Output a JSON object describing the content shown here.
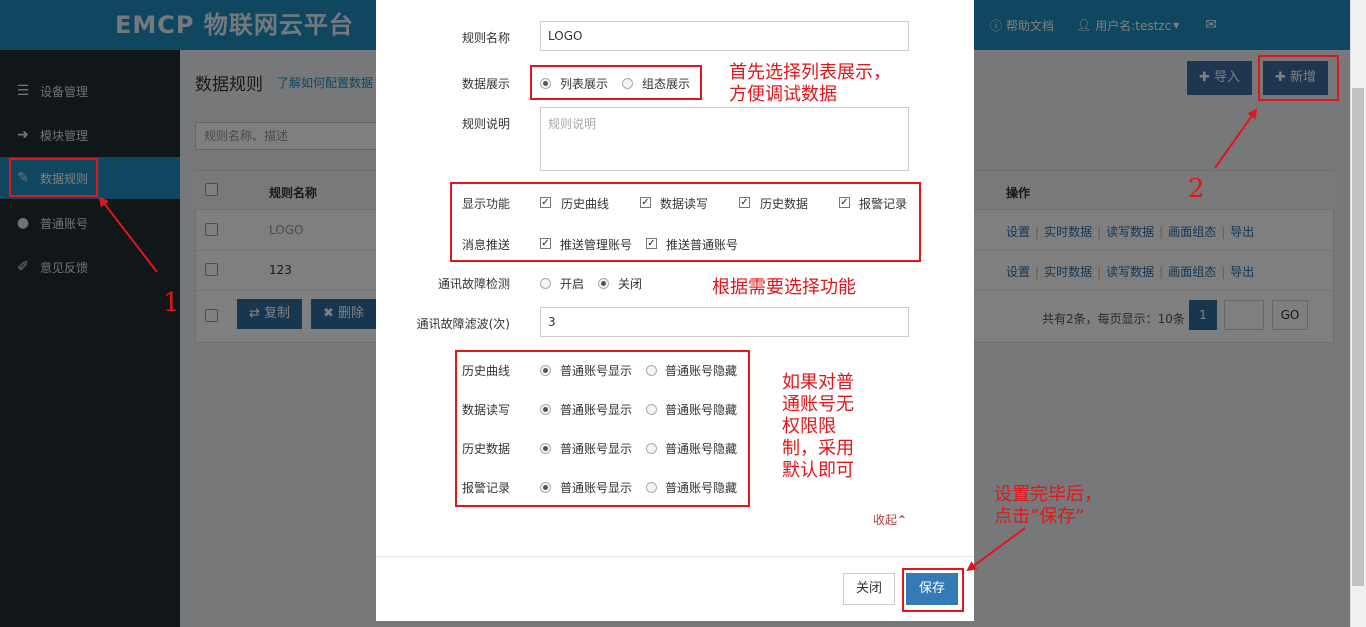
{
  "app": {
    "logo": "EMCP 物联网云平台",
    "help": "帮助文档",
    "user": "用户名:testzc",
    "icons": {
      "help": "question-circle-icon",
      "user": "user-icon",
      "mail": "envelope-icon"
    }
  },
  "sidebar": {
    "items": [
      {
        "label": "设备管理",
        "icon": "list-icon"
      },
      {
        "label": "模块管理",
        "icon": "sign-in-icon"
      },
      {
        "label": "数据规则",
        "icon": "pencil-icon",
        "active": true
      },
      {
        "label": "普通账号",
        "icon": "user-icon"
      },
      {
        "label": "意见反馈",
        "icon": "edit-icon"
      }
    ]
  },
  "main": {
    "title": "数据规则",
    "help_link": "了解如何配置数据",
    "search_placeholder": "规则名称、描述",
    "import_label": "导入",
    "add_label": "新增",
    "table": {
      "col_name": "规则名称",
      "col_ops": "操作",
      "rows": [
        {
          "name": "LOGO"
        },
        {
          "name": "123"
        }
      ],
      "ops": [
        "设置",
        "实时数据",
        "读写数据",
        "画面组态",
        "导出"
      ]
    },
    "copy_label": "复制",
    "delete_label": "删除",
    "pagination_info": "共有2条，每页显示：10条",
    "current_page": "1",
    "go_label": "GO"
  },
  "modal": {
    "rule_name_label": "规则名称",
    "rule_name_value": "LOGO",
    "display_label": "数据展示",
    "display_list": "列表展示",
    "display_config": "组态展示",
    "desc_label": "规则说明",
    "desc_placeholder": "规则说明",
    "func_label": "显示功能",
    "func_options": [
      "历史曲线",
      "数据读写",
      "历史数据",
      "报警记录"
    ],
    "push_label": "消息推送",
    "push_options": [
      "推送管理账号",
      "推送普通账号"
    ],
    "fault_label": "通讯故障检测",
    "fault_on": "开启",
    "fault_off": "关闭",
    "filter_label": "通讯故障滤波(次)",
    "filter_value": "3",
    "perm_rows": [
      "历史曲线",
      "数据读写",
      "历史数据",
      "报警记录"
    ],
    "perm_show": "普通账号显示",
    "perm_hide": "普通账号隐藏",
    "collapse": "收起",
    "close_label": "关闭",
    "save_label": "保存"
  },
  "annotations": {
    "a1_line1": "首先选择列表展示，",
    "a1_line2": "方便调试数据",
    "a2": "根据需要选择功能",
    "a3_lines": [
      "如果对普",
      "通账号无",
      "权限限",
      "制，采用",
      "默认即可"
    ],
    "a4_line1": "设置完毕后，",
    "a4_line2": "点击“保存”",
    "num1": "1",
    "num2": "2"
  },
  "colors": {
    "topbar": "#1f8dc1",
    "sidebar": "#222d32",
    "annotation_red": "#e0161b",
    "primary": "#337ab7"
  }
}
